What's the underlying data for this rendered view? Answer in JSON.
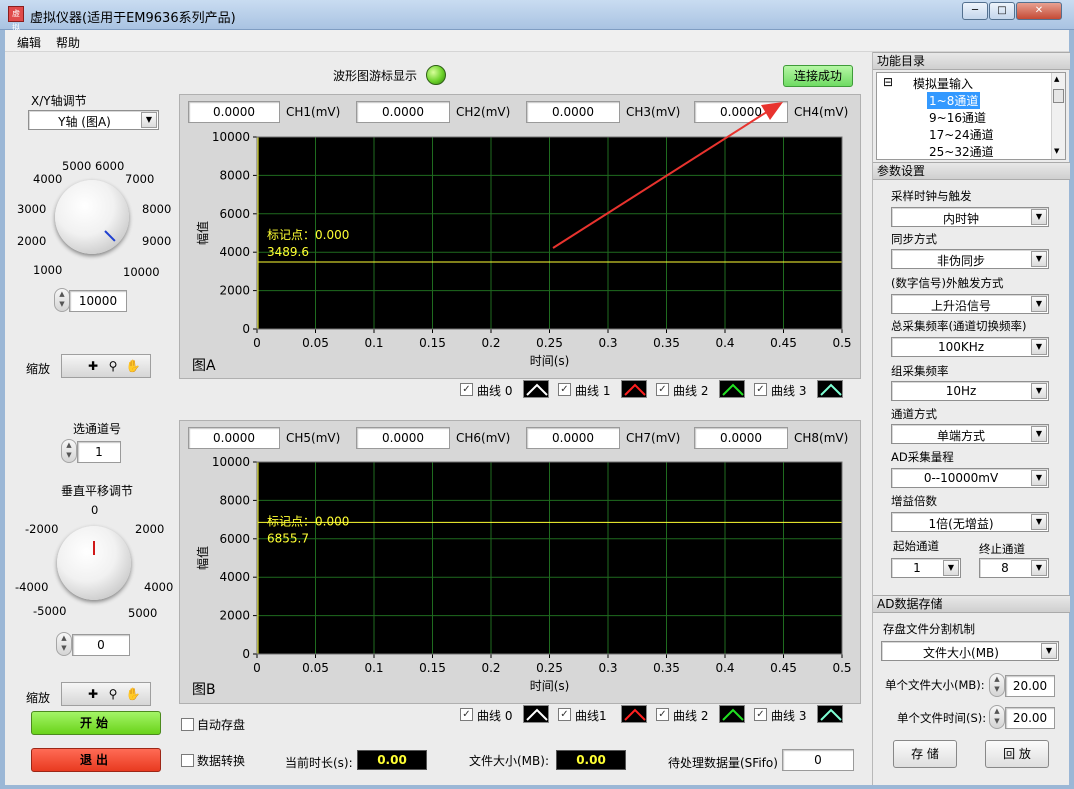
{
  "window": {
    "title": "虚拟仪器(适用于EM9636系列产品)",
    "icon_text": "虚拟",
    "controls": [
      "minimize",
      "maximize",
      "close"
    ]
  },
  "menu": [
    "编辑",
    "帮助"
  ],
  "cursor_display": {
    "label": "波形图游标显示",
    "led_color": "#6cd22a"
  },
  "connect_button": "连接成功",
  "xy_axis": {
    "label": "X/Y轴调节",
    "selected": "Y轴 (图A)"
  },
  "knob_top": {
    "ticks": [
      "1000",
      "2000",
      "3000",
      "4000",
      "5000",
      "6000",
      "7000",
      "8000",
      "9000",
      "10000"
    ],
    "value": "10000"
  },
  "zoom_label": "缩放",
  "channel_select": {
    "label": "选通道号",
    "value": "1"
  },
  "vertical_offset": {
    "label": "垂直平移调节",
    "ticks": [
      "-5000",
      "-4000",
      "-2000",
      "0",
      "2000",
      "4000",
      "5000"
    ],
    "value": "0"
  },
  "start_button": "开始",
  "exit_button": "退出",
  "chart_a": {
    "channels": [
      {
        "value": "0.0000",
        "name": "CH1(mV)"
      },
      {
        "value": "0.0000",
        "name": "CH2(mV)"
      },
      {
        "value": "0.0000",
        "name": "CH3(mV)"
      },
      {
        "value": "0.0000",
        "name": "CH4(mV)"
      }
    ],
    "name": "图A",
    "marker_label": "标记点：0.000",
    "marker_value": "3489.6",
    "legend": [
      "曲线 0",
      "曲线 1",
      "曲线 2",
      "曲线 3"
    ]
  },
  "chart_b": {
    "channels": [
      {
        "value": "0.0000",
        "name": "CH5(mV)"
      },
      {
        "value": "0.0000",
        "name": "CH6(mV)"
      },
      {
        "value": "0.0000",
        "name": "CH7(mV)"
      },
      {
        "value": "0.0000",
        "name": "CH8(mV)"
      }
    ],
    "name": "图B",
    "marker_label": "标记点：0.000",
    "marker_value": "6855.7",
    "legend": [
      "曲线 0",
      "曲线1",
      "曲线 2",
      "曲线 3"
    ]
  },
  "chart_data": [
    {
      "type": "line",
      "xlabel": "时间(s)",
      "ylabel": "幅值",
      "xlim": [
        0,
        0.5
      ],
      "ylim": [
        0,
        10000
      ],
      "x_ticks": [
        "0",
        "0.05",
        "0.1",
        "0.15",
        "0.2",
        "0.25",
        "0.3",
        "0.35",
        "0.4",
        "0.45",
        "0.5"
      ],
      "y_ticks": [
        "0",
        "2000",
        "4000",
        "6000",
        "8000",
        "10000"
      ],
      "grid": true,
      "cursor": {
        "x": 0,
        "y": 3489.6
      },
      "series_colors": [
        "#ffffff",
        "#ff2020",
        "#22e022",
        "#7fffd4"
      ]
    },
    {
      "type": "line",
      "xlabel": "时间(s)",
      "ylabel": "幅值",
      "xlim": [
        0,
        0.5
      ],
      "ylim": [
        0,
        10000
      ],
      "x_ticks": [
        "0",
        "0.05",
        "0.1",
        "0.15",
        "0.2",
        "0.25",
        "0.3",
        "0.35",
        "0.4",
        "0.45",
        "0.5"
      ],
      "y_ticks": [
        "0",
        "2000",
        "4000",
        "6000",
        "8000",
        "10000"
      ],
      "grid": true,
      "cursor": {
        "x": 0,
        "y": 6855.7
      },
      "series_colors": [
        "#ffffff",
        "#ff2020",
        "#22e022",
        "#7fffd4"
      ]
    }
  ],
  "bottom": {
    "auto_save": "自动存盘",
    "data_convert": "数据转换",
    "duration_label": "当前时长(s):",
    "duration_value": "0.00",
    "filesize_label": "文件大小(MB):",
    "filesize_value": "0.00",
    "pending_label": "待处理数据量(SFifo)",
    "pending_value": "0"
  },
  "right_panel": {
    "func_title": "功能目录",
    "tree_parent": "模拟量输入",
    "tree_items": [
      "1~8通道",
      "9~16通道",
      "17~24通道",
      "25~32通道"
    ],
    "params_title": "参数设置",
    "params": [
      {
        "label": "采样时钟与触发",
        "value": "内时钟"
      },
      {
        "label": "同步方式",
        "value": "非伪同步"
      },
      {
        "label": "(数字信号)外触发方式",
        "value": "上升沿信号"
      },
      {
        "label": "总采集频率(通道切换频率)",
        "value": "100KHz"
      },
      {
        "label": "组采集频率",
        "value": "10Hz"
      },
      {
        "label": "通道方式",
        "value": "单端方式"
      },
      {
        "label": "AD采集量程",
        "value": "0--10000mV"
      },
      {
        "label": "增益倍数",
        "value": "1倍(无增益)"
      }
    ],
    "start_channel": {
      "label": "起始通道",
      "value": "1"
    },
    "end_channel": {
      "label": "终止通道",
      "value": "8"
    },
    "storage_title": "AD数据存储",
    "split_label": "存盘文件分割机制",
    "split_value": "文件大小(MB)",
    "file_size_label": "单个文件大小(MB):",
    "file_size_value": "20.00",
    "file_time_label": "单个文件时间(S):",
    "file_time_value": "20.00",
    "save_button": "存 储",
    "replay_button": "回 放"
  }
}
